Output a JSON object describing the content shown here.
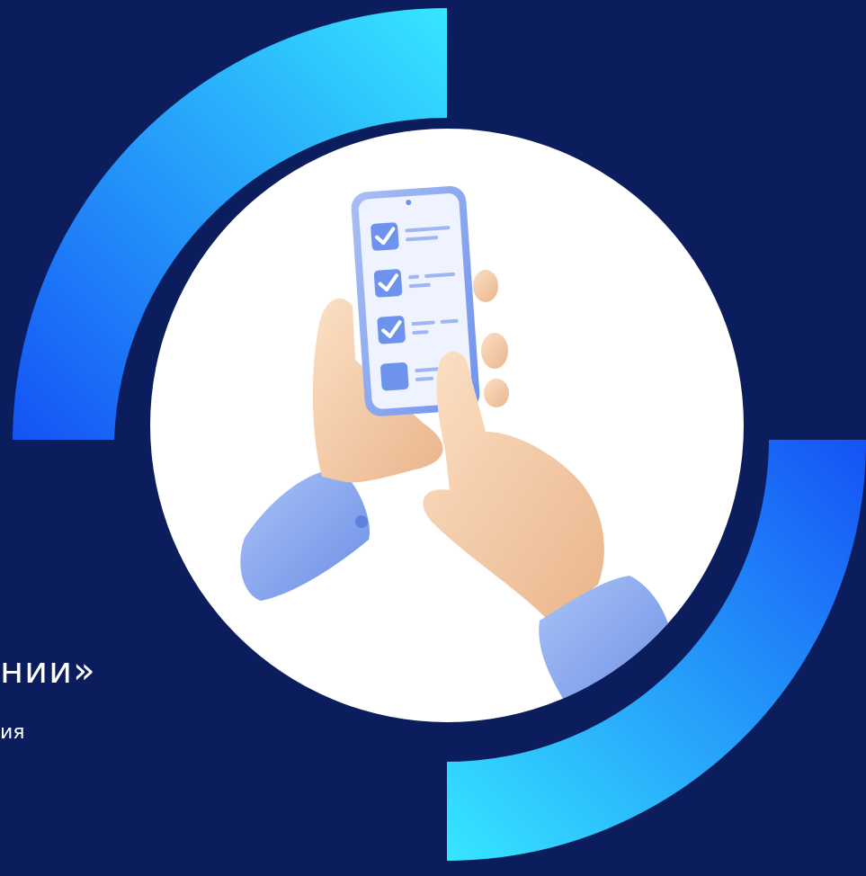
{
  "slide": {
    "title_fragment": "нии»",
    "subtitle_fragment": "ия"
  },
  "colors": {
    "background": "#0b1d5c",
    "arc_light": "#36e6ff",
    "arc_dark": "#1552f5",
    "circle": "#ffffff",
    "phone_body": "#7fa0ee",
    "phone_screen": "#eef3ff",
    "checkbox": "#6e93ee",
    "skin": "#f6cfa8",
    "sleeve": "#7ea2ef"
  },
  "illustration": {
    "subject": "hands-holding-phone-with-checklist",
    "checklist_checked": 3,
    "checklist_total": 4
  }
}
